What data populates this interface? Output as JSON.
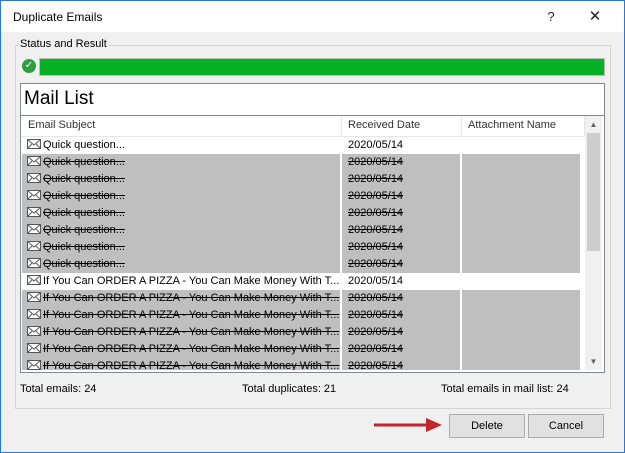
{
  "window": {
    "title": "Duplicate Emails",
    "help_label": "?",
    "close_label": "✕"
  },
  "status": {
    "group_label": "Status and Result",
    "progress_fraction": 1.0,
    "icon": "check-circle-icon"
  },
  "mail_list": {
    "title": "Mail List",
    "columns": [
      "Email Subject",
      "Received Date",
      "Attachment Name"
    ],
    "rows": [
      {
        "subject": "Quick question...",
        "date": "2020/05/14",
        "attachment": "",
        "duplicate": false
      },
      {
        "subject": "Quick question...",
        "date": "2020/05/14",
        "attachment": "",
        "duplicate": true
      },
      {
        "subject": "Quick question...",
        "date": "2020/05/14",
        "attachment": "",
        "duplicate": true
      },
      {
        "subject": "Quick question...",
        "date": "2020/05/14",
        "attachment": "",
        "duplicate": true
      },
      {
        "subject": "Quick question...",
        "date": "2020/05/14",
        "attachment": "",
        "duplicate": true
      },
      {
        "subject": "Quick question...",
        "date": "2020/05/14",
        "attachment": "",
        "duplicate": true
      },
      {
        "subject": "Quick question...",
        "date": "2020/05/14",
        "attachment": "",
        "duplicate": true
      },
      {
        "subject": "Quick question...",
        "date": "2020/05/14",
        "attachment": "",
        "duplicate": true
      },
      {
        "subject": "If You Can ORDER A PIZZA - You Can Make Money With T...",
        "date": "2020/05/14",
        "attachment": "",
        "duplicate": false
      },
      {
        "subject": "If You Can ORDER A PIZZA - You Can Make Money With T...",
        "date": "2020/05/14",
        "attachment": "",
        "duplicate": true
      },
      {
        "subject": "If You Can ORDER A PIZZA - You Can Make Money With T...",
        "date": "2020/05/14",
        "attachment": "",
        "duplicate": true
      },
      {
        "subject": "If You Can ORDER A PIZZA - You Can Make Money With T...",
        "date": "2020/05/14",
        "attachment": "",
        "duplicate": true
      },
      {
        "subject": "If You Can ORDER A PIZZA - You Can Make Money With T...",
        "date": "2020/05/14",
        "attachment": "",
        "duplicate": true
      },
      {
        "subject": "If You Can ORDER A PIZZA - You Can Make Money With T...",
        "date": "2020/05/14",
        "attachment": "",
        "duplicate": true
      }
    ]
  },
  "stats": {
    "total_emails": "Total emails:  24",
    "total_duplicates": "Total duplicates:  21",
    "total_in_list": "Total emails in mail list:  24"
  },
  "buttons": {
    "delete_label": "Delete",
    "cancel_label": "Cancel"
  },
  "colors": {
    "progress": "#06b025",
    "duplicate_row": "#bfbfbf",
    "arrow": "#c0262c",
    "title_border": "#2b78d6"
  }
}
